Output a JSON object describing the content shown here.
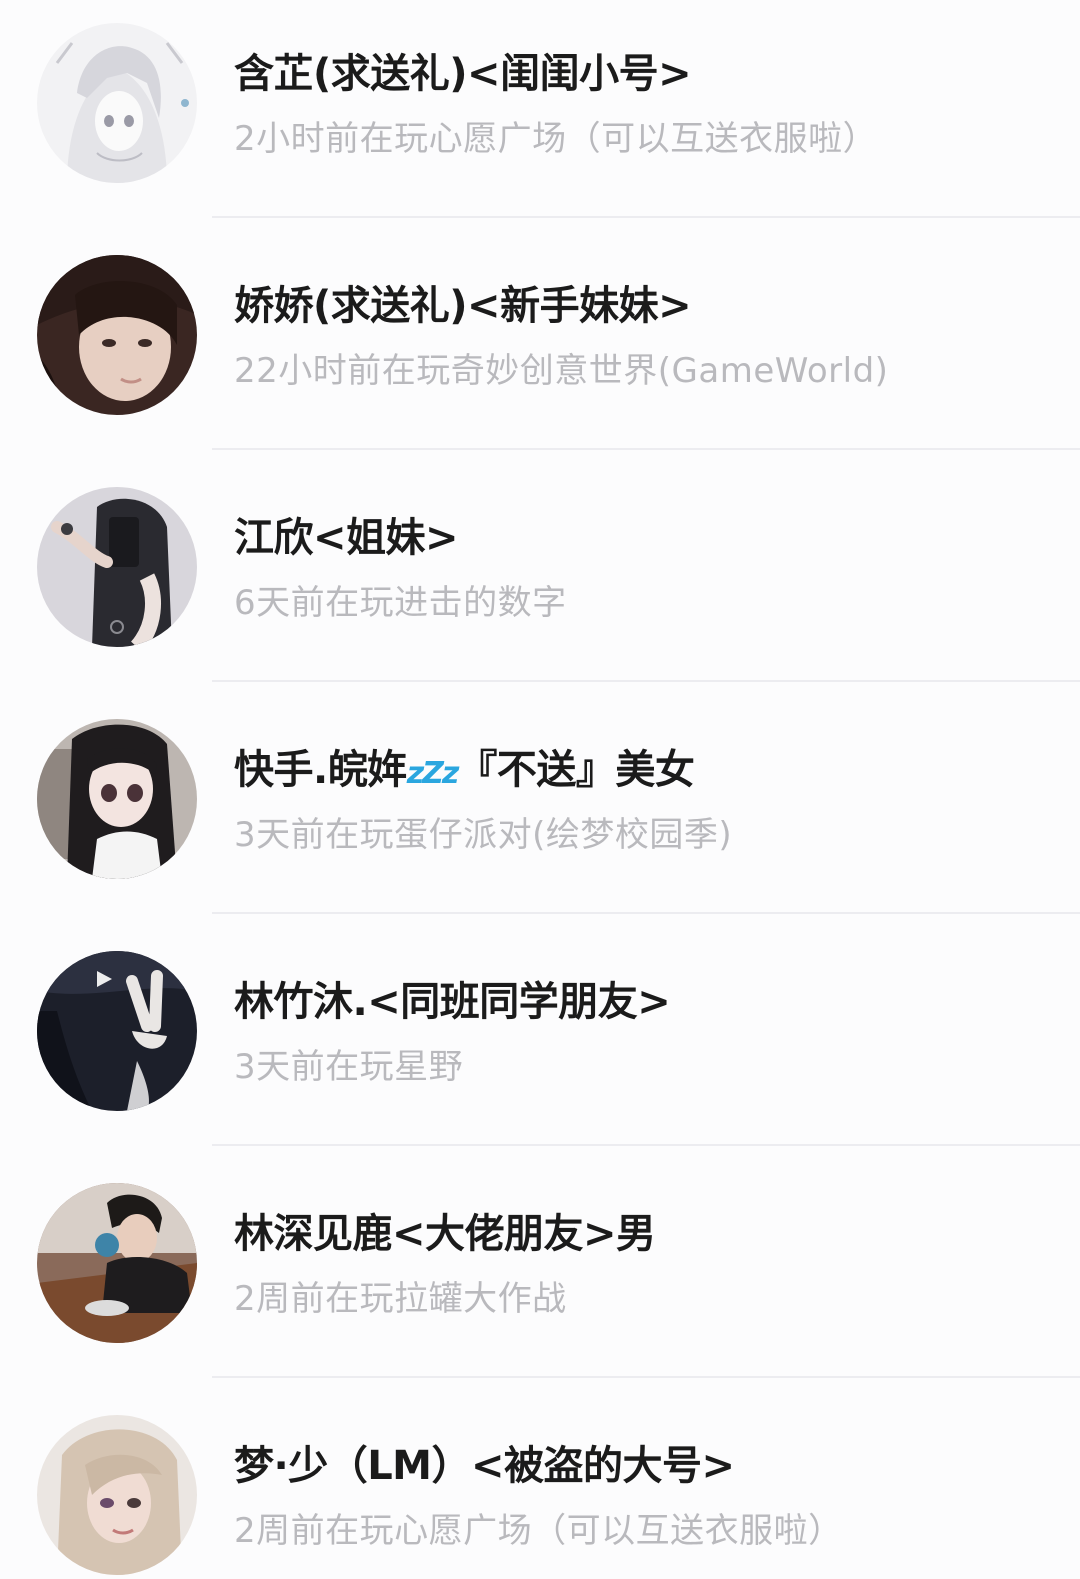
{
  "friends": [
    {
      "name": "含芷(求送礼)<闺闺小号>",
      "status": "2小时前在玩心愿广场（可以互送衣服啦）",
      "avatar_icon": "avatar-anime-girl-sketch"
    },
    {
      "name": "娇娇(求送礼)<新手妹妹>",
      "status": "22小时前在玩奇妙创意世界(GameWorld)",
      "avatar_icon": "avatar-girl-photo"
    },
    {
      "name": "江欣<姐妹>",
      "status": "6天前在玩进击的数字",
      "avatar_icon": "avatar-mirror-selfie"
    },
    {
      "name_prefix": "快手.皖",
      "name_mid": "姩",
      "name_zzz": "zZz",
      "name_suffix": "『不送』美女",
      "status": "3天前在玩蛋仔派对(绘梦校园季)",
      "avatar_icon": "avatar-doll-girl"
    },
    {
      "name": "林竹沐.<同班同学朋友>",
      "status": "3天前在玩星野",
      "avatar_icon": "avatar-dark-peace-sign"
    },
    {
      "name": "林深见鹿<大佬朋友>男",
      "status": "2周前在玩拉罐大作战",
      "avatar_icon": "avatar-boy-cafe"
    },
    {
      "name": "梦·少（LM）<被盗的大号>",
      "status": "2周前在玩心愿广场（可以互送衣服啦）",
      "avatar_icon": "avatar-blonde-girl"
    }
  ],
  "colors": {
    "background": "#fcfcfd",
    "name_text": "#1b1b1b",
    "status_text": "#b9b9bd",
    "divider": "#ececf0",
    "zzz_emoji": "#2aa6df"
  }
}
